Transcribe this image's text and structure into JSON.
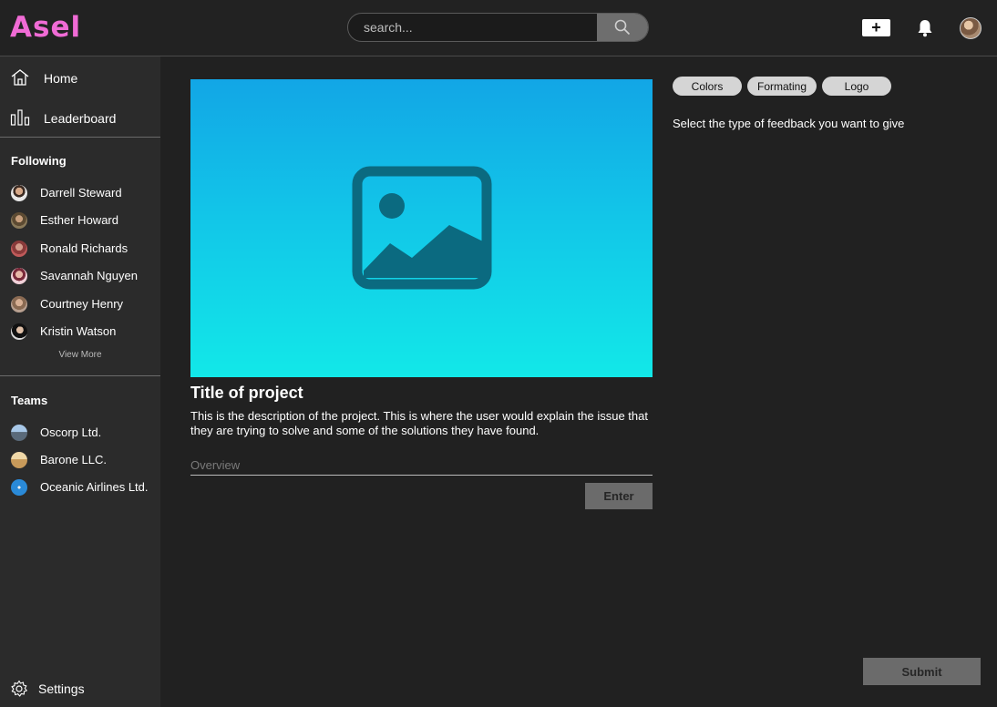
{
  "app": {
    "logo": "Asel"
  },
  "search": {
    "placeholder": "search..."
  },
  "header": {
    "add_label": "+"
  },
  "sidebar": {
    "nav": [
      {
        "label": "Home",
        "icon": "home-icon"
      },
      {
        "label": "Leaderboard",
        "icon": "bar-chart-icon"
      }
    ],
    "following_title": "Following",
    "following": [
      {
        "name": "Darrell Steward"
      },
      {
        "name": "Esther Howard"
      },
      {
        "name": "Ronald Richards"
      },
      {
        "name": "Savannah Nguyen"
      },
      {
        "name": "Courtney Henry"
      },
      {
        "name": "Kristin Watson"
      }
    ],
    "view_more": "View More",
    "teams_title": "Teams",
    "teams": [
      {
        "name": "Oscorp Ltd."
      },
      {
        "name": "Barone LLC."
      },
      {
        "name": "Oceanic Airlines Ltd."
      }
    ],
    "settings_label": "Settings"
  },
  "project": {
    "title": "Title of project",
    "description": "This is the description of the project. This is where the user would explain the issue that they are trying to solve and some of the solutions they have found.",
    "overview_placeholder": "Overview",
    "enter_label": "Enter"
  },
  "feedback": {
    "chips": [
      "Colors",
      "Formating",
      "Logo"
    ],
    "hint": "Select the type of feedback you want to give",
    "submit_label": "Submit"
  },
  "colors": {
    "brand": "#f06bd5",
    "image_top": "#12a6e6",
    "image_bottom": "#12e8e8"
  }
}
